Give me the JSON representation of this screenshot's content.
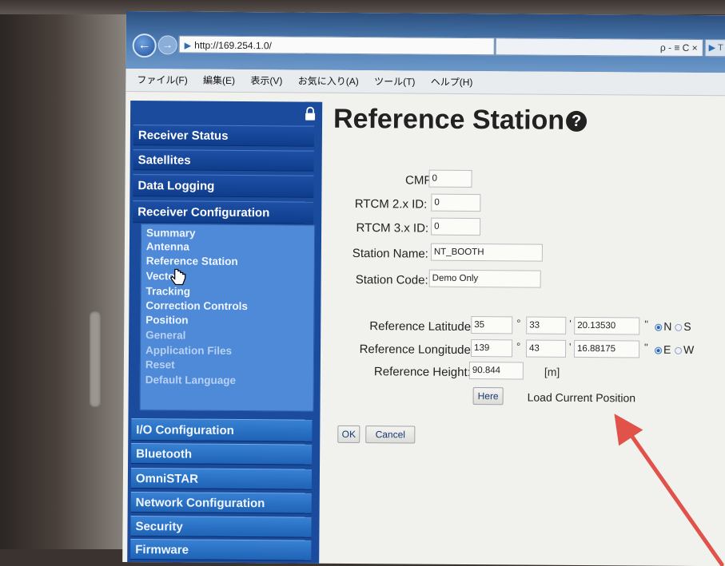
{
  "browser": {
    "url": "http://169.254.1.0/",
    "search_controls": "ρ - ≡ C ×",
    "tab_stub": "T",
    "menu": [
      "ファイル(F)",
      "編集(E)",
      "表示(V)",
      "お気に入り(A)",
      "ツール(T)",
      "ヘルプ(H)"
    ]
  },
  "sidebar": {
    "groups": [
      "Receiver Status",
      "Satellites",
      "Data Logging",
      "Receiver Configuration"
    ],
    "submenu": [
      "Summary",
      "Antenna",
      "Reference Station",
      "Vector",
      "Tracking",
      "Correction Controls",
      "Position",
      "General",
      "Application Files",
      "Reset",
      "Default Language"
    ],
    "groups_bottom": [
      "I/O Configuration",
      "Bluetooth",
      "OmniSTAR",
      "Network Configuration",
      "Security",
      "Firmware"
    ]
  },
  "page": {
    "title": "Reference Station",
    "help_glyph": "?"
  },
  "form": {
    "cmr_id": {
      "label": "CMR ID:",
      "value": "0"
    },
    "rtcm2_id": {
      "label": "RTCM 2.x ID:",
      "value": "0"
    },
    "rtcm3_id": {
      "label": "RTCM 3.x ID:",
      "value": "0"
    },
    "station_name": {
      "label": "Station Name:",
      "value": "NT_BOOTH"
    },
    "station_code": {
      "label": "Station Code:",
      "value": "Demo Only"
    },
    "latitude": {
      "label": "Reference Latitude:",
      "deg": "35",
      "min": "33",
      "sec": "20.13530",
      "hemisphere_options": [
        "N",
        "S"
      ],
      "selected": "N"
    },
    "longitude": {
      "label": "Reference Longitude:",
      "deg": "139",
      "min": "43",
      "sec": "16.88175",
      "hemisphere_options": [
        "E",
        "W"
      ],
      "selected": "E"
    },
    "height": {
      "label": "Reference Height:",
      "value": "90.844",
      "unit": "[m]"
    },
    "here_button": "Here",
    "load_label": "Load Current Position",
    "ok_button": "OK",
    "cancel_button": "Cancel",
    "deg_mark": "°",
    "min_mark": "'",
    "sec_mark": "\""
  },
  "colors": {
    "sidebar_bg": "#1a4b9d",
    "submenu_bg": "#4f8ad8",
    "arrow": "#e0524a"
  }
}
